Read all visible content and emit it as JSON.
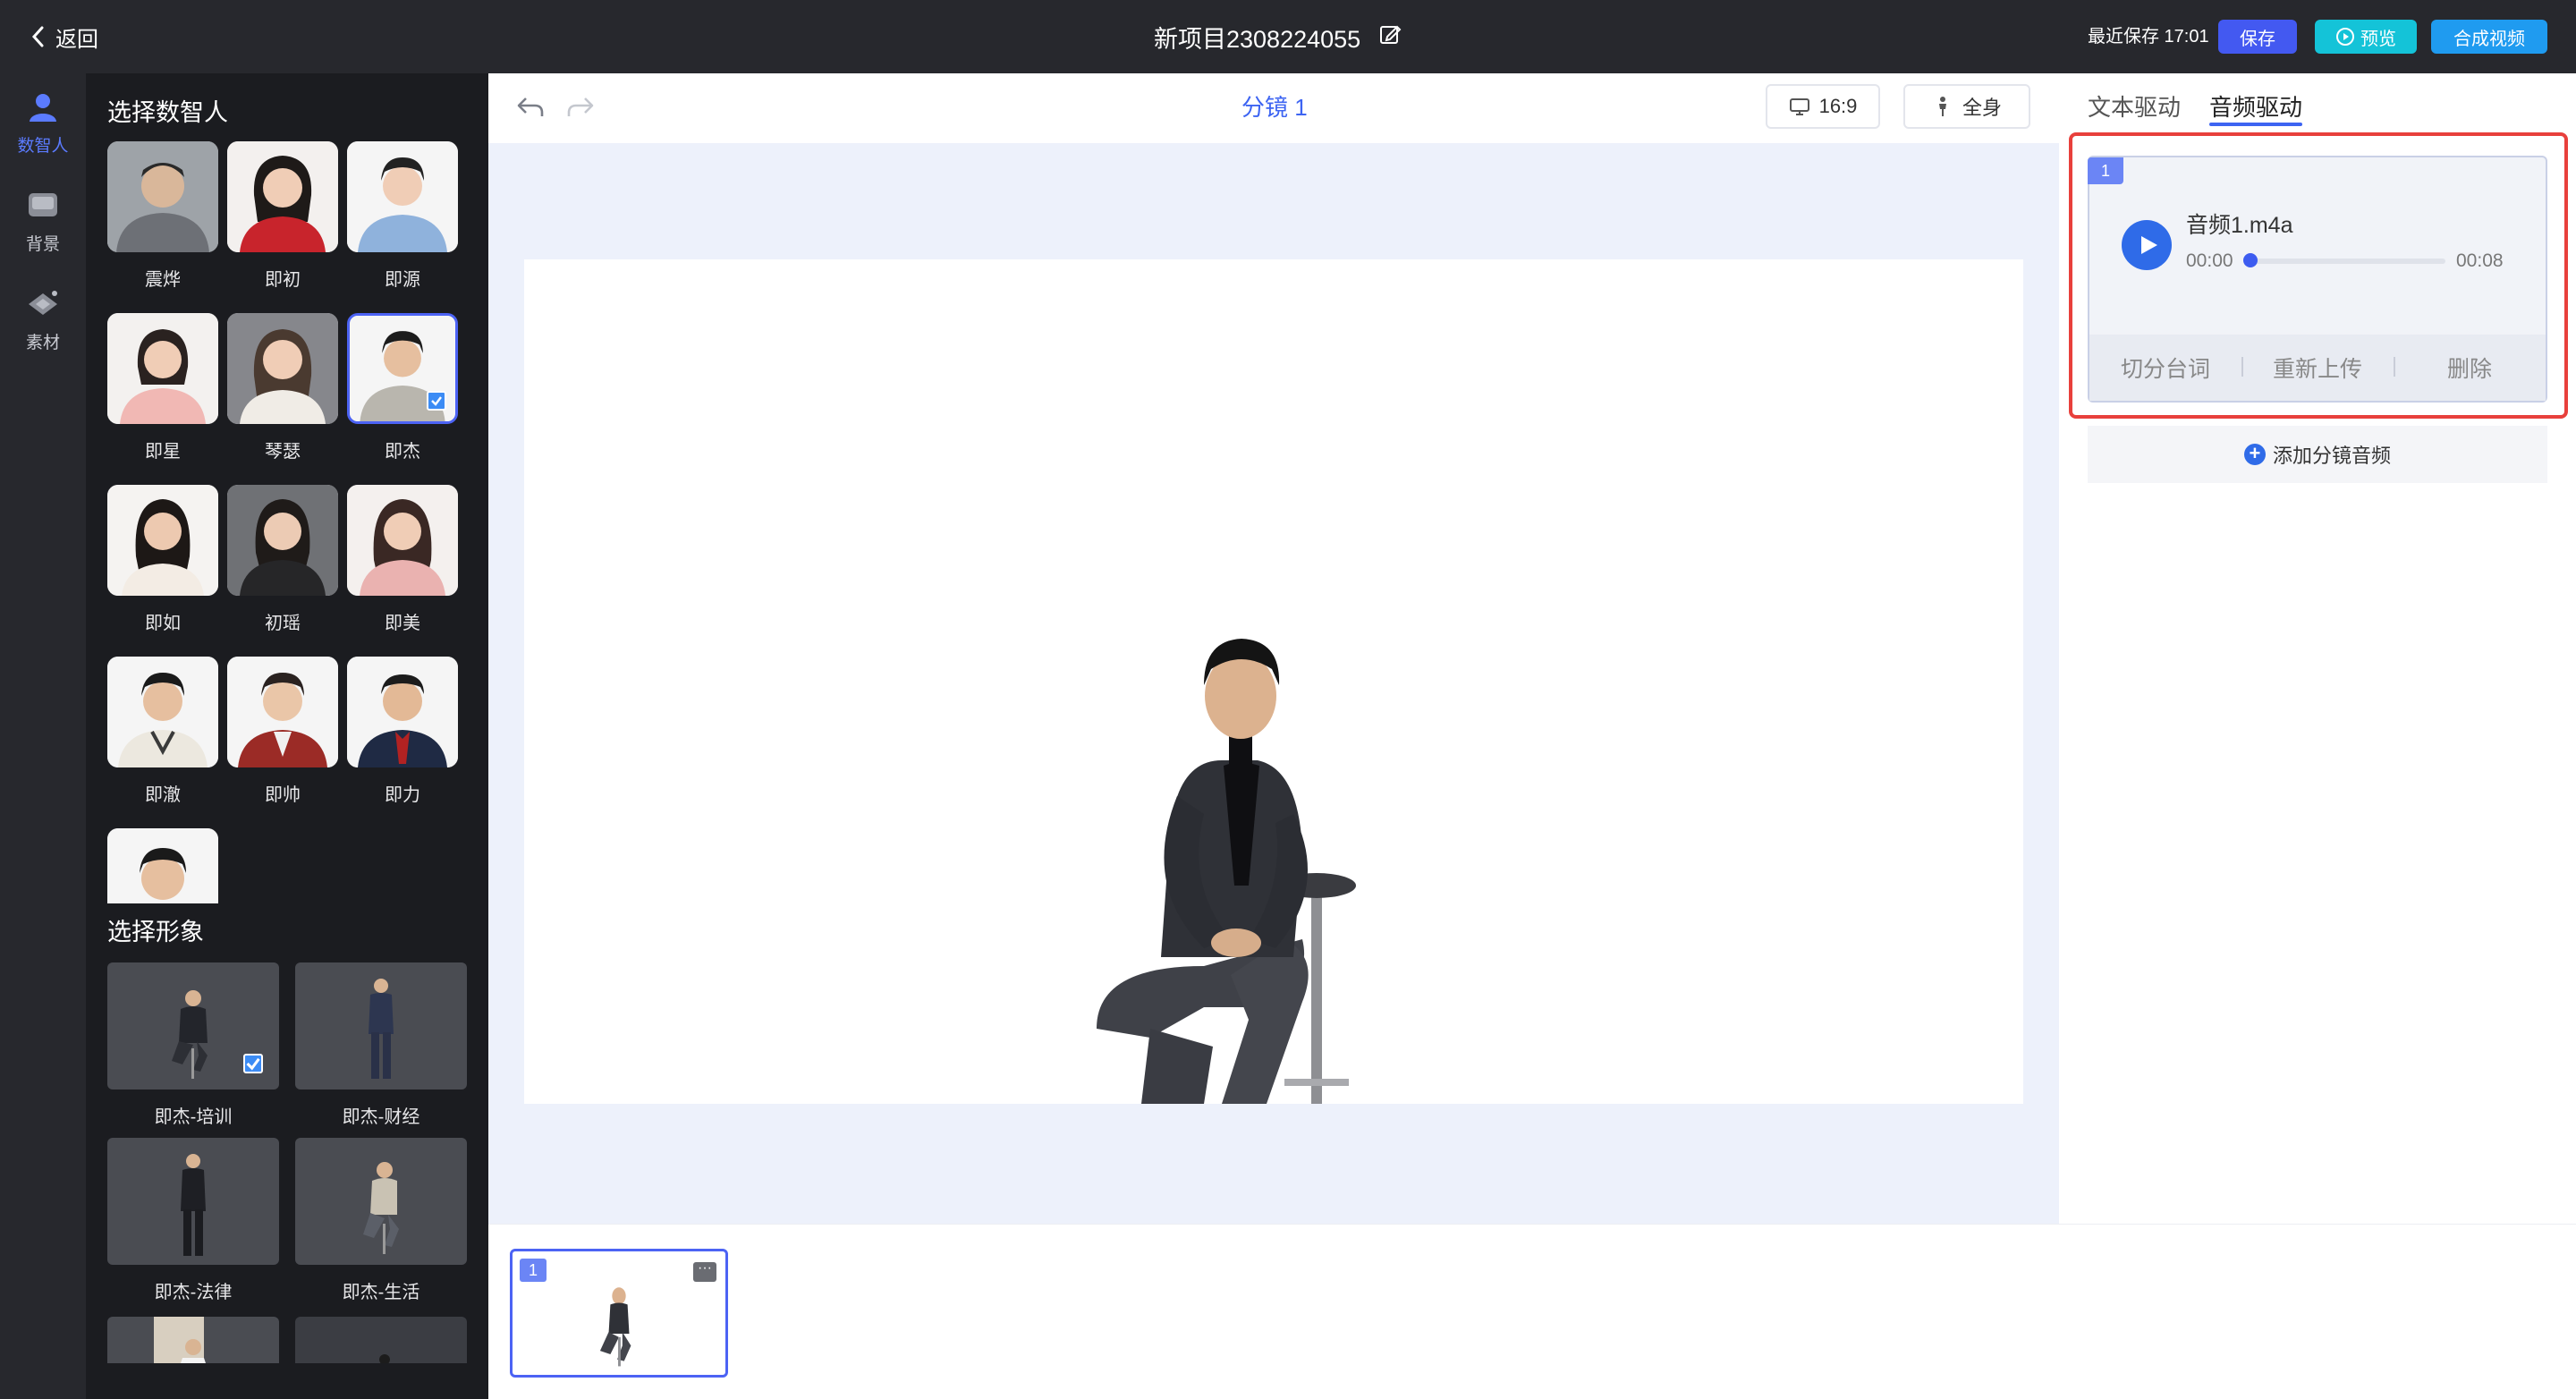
{
  "header": {
    "back_label": "返回",
    "project_title": "新项目2308224055",
    "last_save": "最近保存 17:01",
    "save_label": "保存",
    "preview_label": "预览",
    "compose_label": "合成视频"
  },
  "rail": {
    "items": [
      {
        "label": "数智人",
        "icon": "person-icon",
        "active": true
      },
      {
        "label": "背景",
        "icon": "background-icon",
        "active": false
      },
      {
        "label": "素材",
        "icon": "material-icon",
        "active": false
      }
    ]
  },
  "panel": {
    "avatar_title": "选择数智人",
    "avatars": [
      "震烨",
      "即初",
      "即源",
      "即星",
      "琴瑟",
      "即杰",
      "即如",
      "初瑶",
      "即美",
      "即澈",
      "即帅",
      "即力"
    ],
    "selected_avatar": "即杰",
    "image_title": "选择形象",
    "images": [
      "即杰-培训",
      "即杰-财经",
      "即杰-法律",
      "即杰-生活"
    ],
    "selected_image": "即杰-培训"
  },
  "editor": {
    "scene_title": "分镜 1",
    "ratio_label": "16:9",
    "body_label": "全身"
  },
  "timeline": {
    "thumb_number": "1"
  },
  "right": {
    "tab_text": "文本驱动",
    "tab_audio": "音频驱动",
    "active_tab": "音频驱动",
    "audio": {
      "index": "1",
      "file_name": "音频1.m4a",
      "current_time": "00:00",
      "duration": "00:08",
      "progress": 0
    },
    "actions": [
      "切分台词",
      "重新上传",
      "删除"
    ],
    "add_audio_label": "添加分镜音频"
  },
  "colors": {
    "accent": "#3d64f2",
    "save_btn": "#4359f1",
    "preview_btn": "#14c3d8",
    "compose_btn": "#1f9bf0",
    "highlight": "#e8403c"
  }
}
